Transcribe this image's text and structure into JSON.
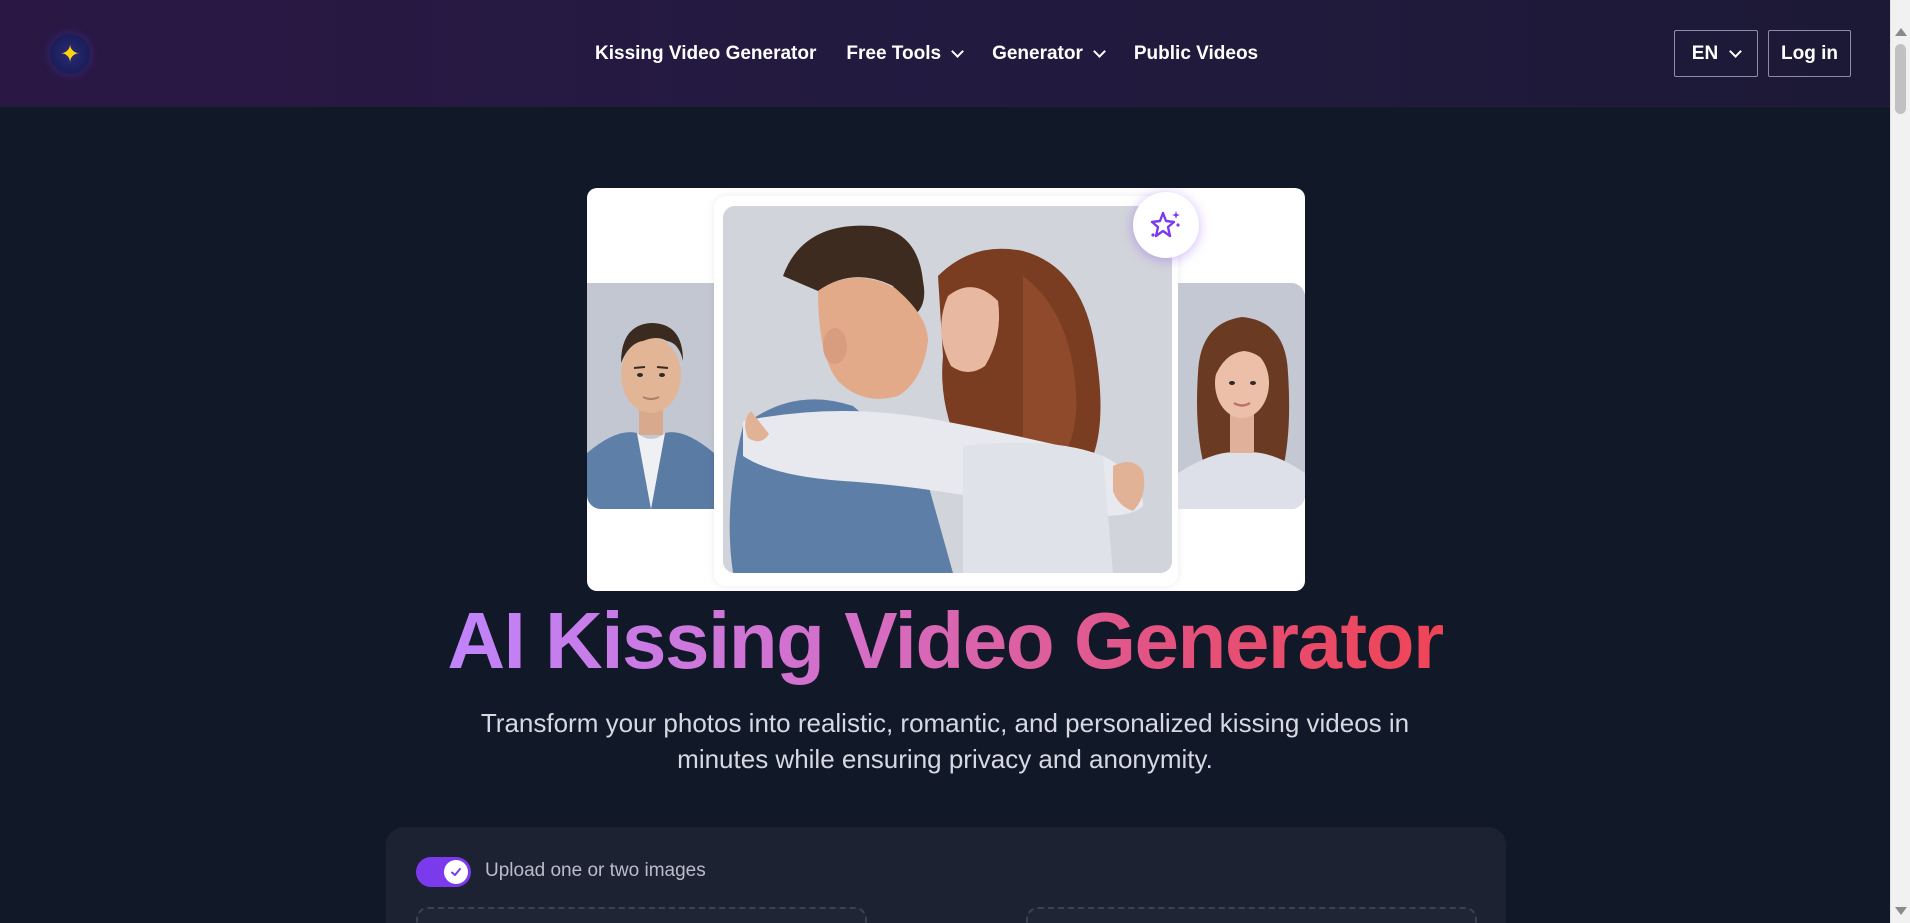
{
  "nav": {
    "items": [
      {
        "label": "Kissing Video Generator",
        "dropdown": false
      },
      {
        "label": "Free Tools",
        "dropdown": true
      },
      {
        "label": "Generator",
        "dropdown": true
      },
      {
        "label": "Public Videos",
        "dropdown": false
      }
    ],
    "language": "EN",
    "login_label": "Log in"
  },
  "hero": {
    "title": "AI Kissing Video Generator",
    "subtitle": "Transform your photos into realistic, romantic, and personalized kissing videos in minutes while ensuring privacy and anonymity."
  },
  "upload": {
    "toggle_on": true,
    "toggle_label": "Upload one or two images"
  },
  "icons": {
    "logo": "sparkle-logo-icon",
    "magic": "magic-sparkles-icon"
  },
  "colors": {
    "page_bg": "#111827",
    "accent": "#7c3aed",
    "title_gradient_start": "#c084fc",
    "title_gradient_end": "#ef4455"
  }
}
